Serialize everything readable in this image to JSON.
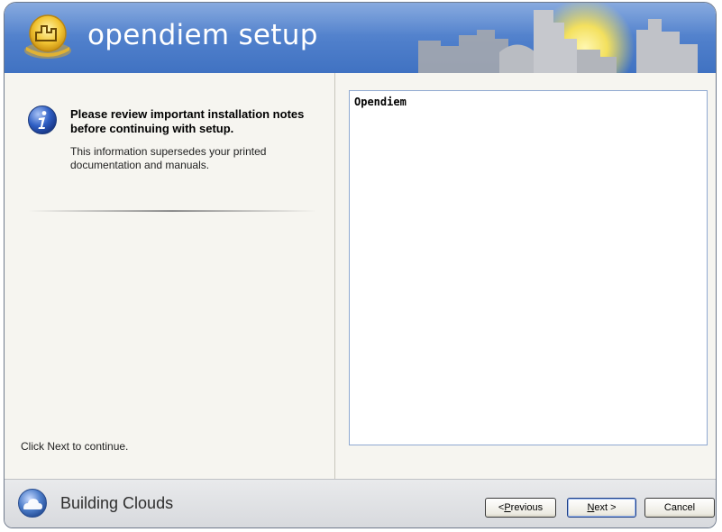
{
  "header": {
    "title": "opendiem setup"
  },
  "left_pane": {
    "headline": "Please review important installation notes before continuing with setup.",
    "subtext": "This information supersedes your printed documentation and manuals.",
    "continue_hint": "Click Next to continue."
  },
  "notes": {
    "content": "Opendiem"
  },
  "footer": {
    "brand": "Building Clouds",
    "buttons": {
      "previous": {
        "prefix": "< ",
        "mnemonic": "P",
        "rest": "revious"
      },
      "next": {
        "mnemonic": "N",
        "rest": "ext >"
      },
      "cancel": "Cancel"
    }
  },
  "colors": {
    "header_blue": "#4f7fcb",
    "notes_border": "#8fa9d1",
    "content_bg": "#f6f5f0"
  },
  "icons": {
    "app_logo": "building-logo-icon",
    "info": "info-icon",
    "brand": "cloud-logo-icon"
  }
}
